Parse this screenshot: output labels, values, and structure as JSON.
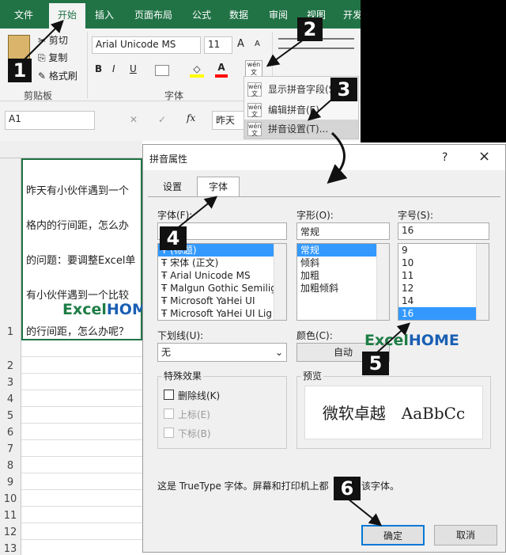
{
  "ribbon_tabs": [
    "文件",
    "开始",
    "插入",
    "页面布局",
    "公式",
    "数据",
    "审阅",
    "视图",
    "开发"
  ],
  "clipboard": {
    "cut": "剪切",
    "copy": "复制",
    "format_painter": "格式刷",
    "group": "剪贴板"
  },
  "font": {
    "name": "Arial Unicode MS",
    "size": "11",
    "group": "字体",
    "bold": "B",
    "italic": "I",
    "underline": "U",
    "grow": "A",
    "shrink": "A",
    "fill_color": "#ffff00",
    "font_color": "#ff0000"
  },
  "name_box": "A1",
  "formula_text": "昨天",
  "menu": {
    "items": [
      "显示拼音字段(S)",
      "编辑拼音(E)",
      "拼音设置(T)..."
    ]
  },
  "markers": [
    "1",
    "2",
    "3",
    "4",
    "5",
    "6"
  ],
  "rows": [
    "1",
    "2",
    "3",
    "4",
    "5",
    "6",
    "7",
    "8",
    "9",
    "10",
    "11",
    "12",
    "13"
  ],
  "cell_lines": [
    "昨天有小伙伴遇到一个",
    "格内的行间距，怎么办",
    "的问题：要调整Excel单",
    "有小伙伴遇到一个比较",
    "的行间距，怎么办呢？"
  ],
  "logo": {
    "excel": "Excel",
    "home": "HOME",
    "excel_color": "#1e7d45",
    "home_color": "#1a5fb4"
  },
  "dialog": {
    "title": "拼音属性",
    "help": "?",
    "close": "×",
    "tabs": [
      "设置",
      "字体"
    ],
    "font_label": "字体(F):",
    "font_value": "",
    "fonts": [
      "(标题)",
      "宋体 (正文)",
      "Arial Unicode MS",
      "Malgun Gothic Semilig",
      "Microsoft YaHei UI",
      "Microsoft YaHei UI Lig"
    ],
    "style_label": "字形(O):",
    "style_value": "常规",
    "styles": [
      "常规",
      "倾斜",
      "加粗",
      "加粗倾斜"
    ],
    "size_label": "字号(S):",
    "size_value": "16",
    "sizes": [
      "9",
      "10",
      "11",
      "12",
      "14",
      "16"
    ],
    "underline_label": "下划线(U):",
    "underline_value": "无",
    "color_label": "颜色(C):",
    "color_value": "自动",
    "effects_label": "特殊效果",
    "strikethrough": "删除线(K)",
    "superscript": "上标(E)",
    "subscript": "下标(B)",
    "preview_label": "预览",
    "preview_text": "微软卓越　AaBbCc",
    "note": "这是 TrueType 字体。屏幕和打印机上都",
    "note_end": "该字体。",
    "ok": "确定",
    "cancel": "取消"
  }
}
